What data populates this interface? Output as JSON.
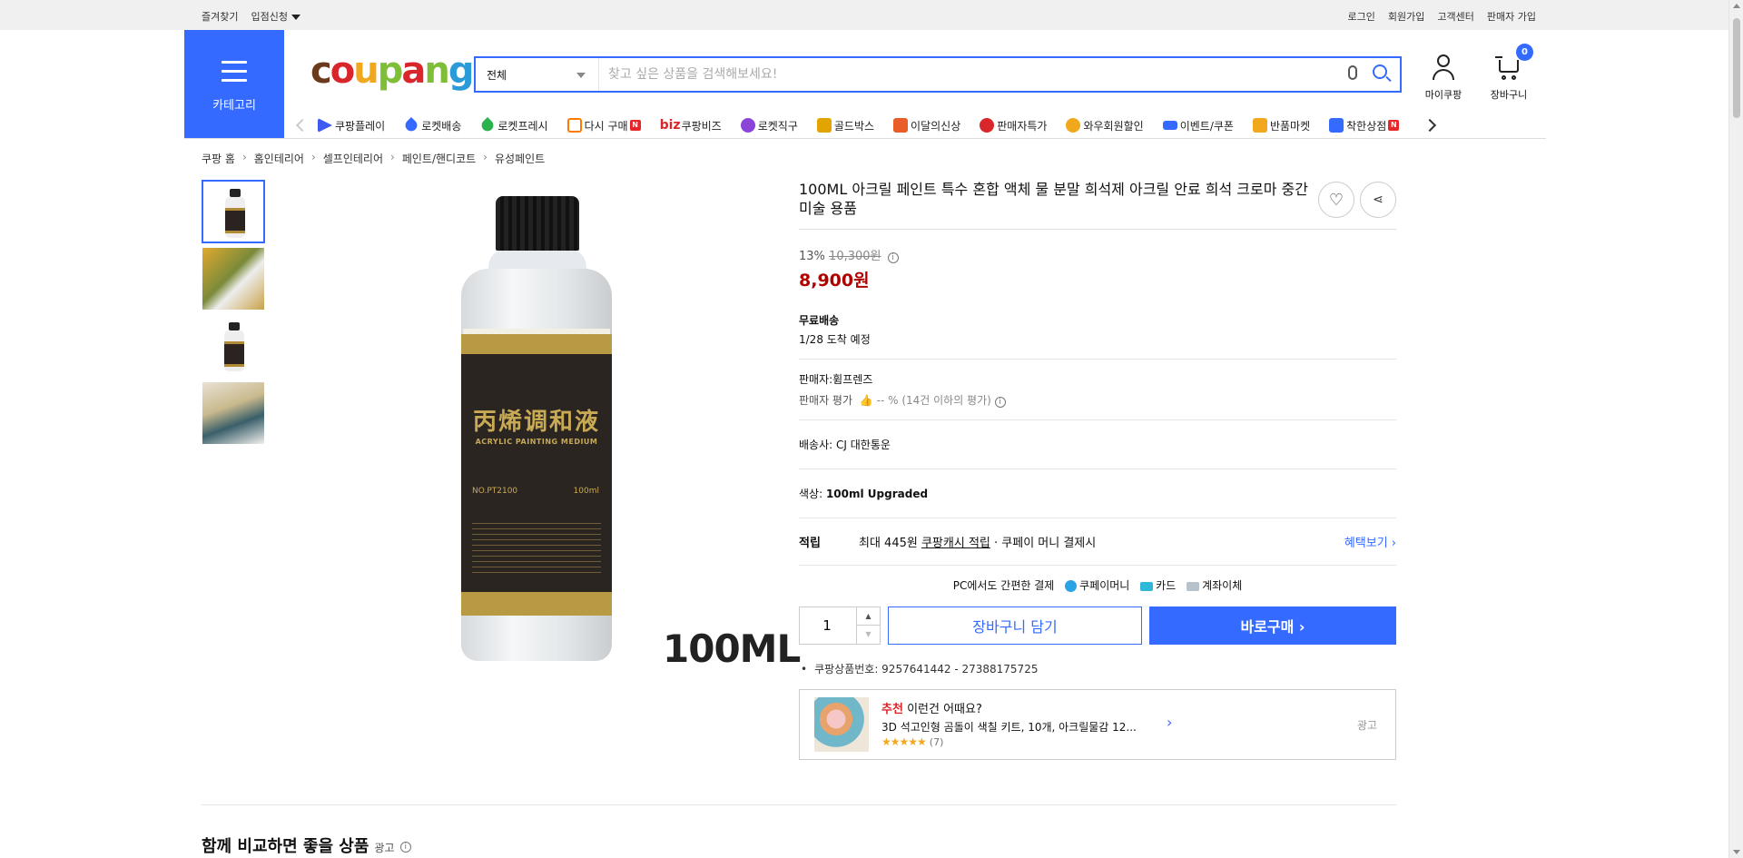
{
  "topbar": {
    "left": [
      "즐겨찾기",
      "입점신청"
    ],
    "right": [
      "로그인",
      "회원가입",
      "고객센터",
      "판매자 가입"
    ]
  },
  "category_button": "카테고리",
  "search": {
    "category": "전체",
    "placeholder": "찾고 싶은 상품을 검색해보세요!"
  },
  "header_icons": {
    "mypage": "마이쿠팡",
    "cart": "장바구니",
    "cart_count": "0"
  },
  "shortcuts": [
    {
      "label": "쿠팡플레이",
      "color": "#3d5af1"
    },
    {
      "label": "로켓배송",
      "color": "#346aff"
    },
    {
      "label": "로켓프레시",
      "color": "#2bb24c"
    },
    {
      "label": "다시 구매",
      "color": "#ff7a00",
      "badge": "N"
    },
    {
      "label": "쿠팡비즈",
      "color": "#d9262b",
      "prefix": "biz"
    },
    {
      "label": "로켓직구",
      "color": "#8a45d8"
    },
    {
      "label": "골드박스",
      "color": "#e2a400"
    },
    {
      "label": "이달의신상",
      "color": "#e95d2b"
    },
    {
      "label": "판매자특가",
      "color": "#d9262b"
    },
    {
      "label": "와우회원할인",
      "color": "#f2a81d"
    },
    {
      "label": "이벤트/쿠폰",
      "color": "#346aff"
    },
    {
      "label": "반품마켓",
      "color": "#f2a81d"
    },
    {
      "label": "착한상점",
      "color": "#346aff",
      "badge": "N"
    }
  ],
  "breadcrumb": [
    "쿠팡 홈",
    "홈인테리어",
    "셀프인테리어",
    "페인트/핸디코트",
    "유성페인트"
  ],
  "product": {
    "title": "100ML 아크릴 페인트 특수 혼합 액체 물 분말 희석제 아크릴 안료 희석 크로마 중간 미술 용품",
    "discount": "13%",
    "original_price": "10,300원",
    "sale_price": "8,900원",
    "shipping_label": "무료배송",
    "arrival": "1/28 도착 예정",
    "seller": "판매자:휨프렌즈",
    "seller_rating_label": "판매자 평가",
    "seller_rating_value": "-- % (14건 이하의 평가)",
    "courier_label": "배송사:",
    "courier": "CJ 대한통운",
    "color_label": "색상:",
    "color": "100ml Upgraded",
    "reward_label": "적립",
    "reward_text1": "최대 445원",
    "reward_link": "쿠팡캐시 적립",
    "reward_text2": "· 쿠페이 머니 결제시",
    "reward_more": "혜택보기 ›",
    "pay_intro": "PC에서도 간편한 결제",
    "pay_money": "쿠페이머니",
    "pay_card": "카드",
    "pay_account": "계좌이체",
    "quantity": "1",
    "add_to_cart": "장바구니 담기",
    "buy_now": "바로구매 ›",
    "product_number": "쿠팡상품번호: 9257641442 - 27388175725",
    "image_caption": "100ML",
    "label_cn": "丙烯调和液",
    "label_en": "ACRYLIC PAINTING MEDIUM",
    "label_no": "NO.PT2100",
    "label_vol": "100ml"
  },
  "recommend": {
    "highlight": "추천",
    "heading": "이런건 어때요?",
    "item": "3D 석고인형 곰돌이 색칠 키트, 10개, 아크릴물감 12...",
    "stars": "★★★★★",
    "review_count": "(7)",
    "ad": "광고"
  },
  "section": {
    "title": "함께 비교하면 좋을 상품",
    "ad": "광고"
  }
}
